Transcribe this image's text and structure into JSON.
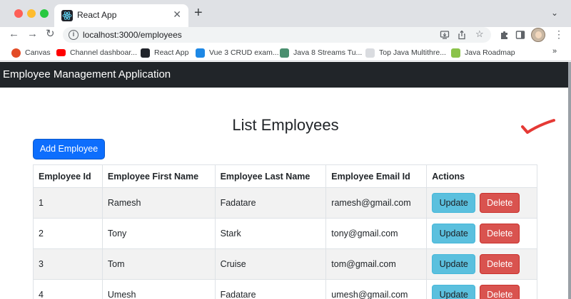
{
  "browser": {
    "tab_title": "React App",
    "tab_close_icon": "close-icon",
    "new_tab_label": "+",
    "tab_menu_label": "⌄",
    "url_host": "localhost",
    "url_rest": ":3000/employees",
    "bookmarks": [
      {
        "label": "Canvas",
        "icon": "canvas-icon",
        "color": "#e34c26"
      },
      {
        "label": "Channel dashboar...",
        "icon": "youtube-icon",
        "color": "#ff0000"
      },
      {
        "label": "React App",
        "icon": "react-icon",
        "color": "#20232a"
      },
      {
        "label": "Vue 3 CRUD exam...",
        "icon": "vue-icon",
        "color": "#1e88e5"
      },
      {
        "label": "Java 8 Streams Tu...",
        "icon": "d-icon",
        "color": "#4a8f6f"
      },
      {
        "label": "Top Java Multithre...",
        "icon": "chart-icon",
        "color": "#9aa0a6"
      },
      {
        "label": "Java Roadmap",
        "icon": "roadmap-icon",
        "color": "#8bc34a"
      }
    ],
    "bookmarks_more": "»"
  },
  "app": {
    "brand": "Employee Management Application",
    "heading": "List Employees",
    "add_button": "Add Employee",
    "columns": [
      "Employee Id",
      "Employee First Name",
      "Employee Last Name",
      "Employee Email Id",
      "Actions"
    ],
    "update_label": "Update",
    "delete_label": "Delete",
    "rows": [
      {
        "id": "1",
        "first": "Ramesh",
        "last": "Fadatare",
        "email": "ramesh@gmail.com"
      },
      {
        "id": "2",
        "first": "Tony",
        "last": "Stark",
        "email": "tony@gmail.com"
      },
      {
        "id": "3",
        "first": "Tom",
        "last": "Cruise",
        "email": "tom@gmail.com"
      },
      {
        "id": "4",
        "first": "Umesh",
        "last": "Fadatare",
        "email": "umesh@gmail.com"
      }
    ],
    "colors": {
      "primary": "#0d6efd",
      "info": "#5bc0de",
      "danger": "#d9534f",
      "navbar": "#212529",
      "annotation": "#e53935"
    }
  }
}
